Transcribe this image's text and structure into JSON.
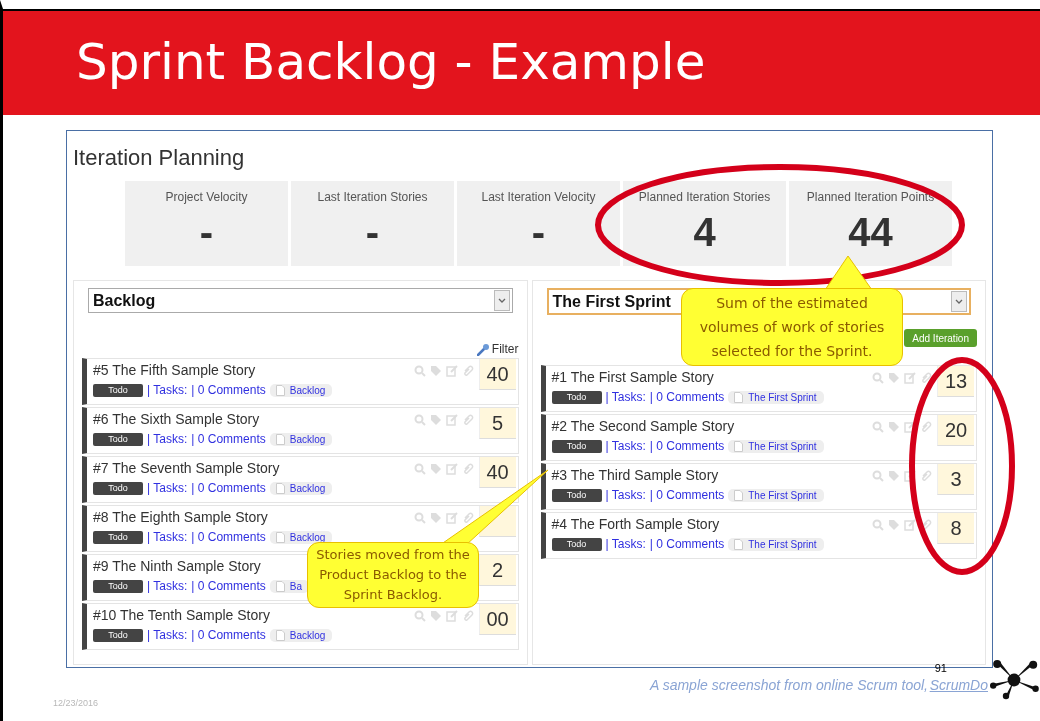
{
  "slide": {
    "title": "Sprint Backlog - Example",
    "caption": "A sample screenshot from online Scrum tool, ",
    "caption_link": "ScrumDo",
    "page_number": "91",
    "date": "12/23/2016"
  },
  "app": {
    "title": "Iteration Planning",
    "stats": [
      {
        "label": "Project Velocity",
        "value": "-"
      },
      {
        "label": "Last Iteration Stories",
        "value": "-"
      },
      {
        "label": "Last Iteration Velocity",
        "value": "-"
      },
      {
        "label": "Planned Iteration Stories",
        "value": "4"
      },
      {
        "label": "Planned Iteration Points",
        "value": "44"
      }
    ],
    "columns": [
      {
        "selector": "Backlog",
        "highlighted": false,
        "tool": {
          "kind": "filter",
          "label": "Filter"
        },
        "stories": [
          {
            "title": "#5 The Fifth Sample Story",
            "status": "Todo",
            "tasks": "| Tasks:",
            "comments": "| 0 Comments",
            "tag": "Backlog",
            "points": "40"
          },
          {
            "title": "#6 The Sixth Sample Story",
            "status": "Todo",
            "tasks": "| Tasks:",
            "comments": "| 0 Comments",
            "tag": "Backlog",
            "points": "5"
          },
          {
            "title": "#7 The Seventh Sample Story",
            "status": "Todo",
            "tasks": "| Tasks:",
            "comments": "| 0 Comments",
            "tag": "Backlog",
            "points": "40"
          },
          {
            "title": "#8 The Eighth Sample Story",
            "status": "Todo",
            "tasks": "| Tasks:",
            "comments": "| 0 Comments",
            "tag": "Backlog"
          },
          {
            "title": "#9 The Ninth Sample Story",
            "status": "Todo",
            "tasks": "| Tasks:",
            "comments": "| 0 Comments",
            "tag": "Ba",
            "points": "2"
          },
          {
            "title": "#10 The Tenth Sample Story",
            "status": "Todo",
            "tasks": "| Tasks:",
            "comments": "| 0 Comments",
            "tag": "Backlog",
            "points": "00"
          }
        ]
      },
      {
        "selector": "The First Sprint",
        "highlighted": true,
        "tool": {
          "kind": "button",
          "label": "Add Iteration"
        },
        "stories": [
          {
            "title": "#1 The First Sample Story",
            "status": "Todo",
            "tasks": "| Tasks:",
            "comments": "| 0 Comments",
            "tag": "The First Sprint",
            "points": "13"
          },
          {
            "title": "#2 The Second Sample Story",
            "status": "Todo",
            "tasks": "| Tasks:",
            "comments": "| 0 Comments",
            "tag": "The First Sprint",
            "points": "20"
          },
          {
            "title": "#3 The Third Sample Story",
            "status": "Todo",
            "tasks": "| Tasks:",
            "comments": "| 0 Comments",
            "tag": "The First Sprint",
            "points": "3"
          },
          {
            "title": "#4 The Forth Sample Story",
            "status": "Todo",
            "tasks": "| Tasks:",
            "comments": "| 0 Comments",
            "tag": "The First Sprint",
            "points": "8"
          }
        ]
      }
    ]
  },
  "callouts": [
    {
      "text": "Sum of the estimated volumes of work of stories selected for the Sprint."
    },
    {
      "text": "Stories moved from the Product Backlog to the Sprint Backlog."
    }
  ]
}
